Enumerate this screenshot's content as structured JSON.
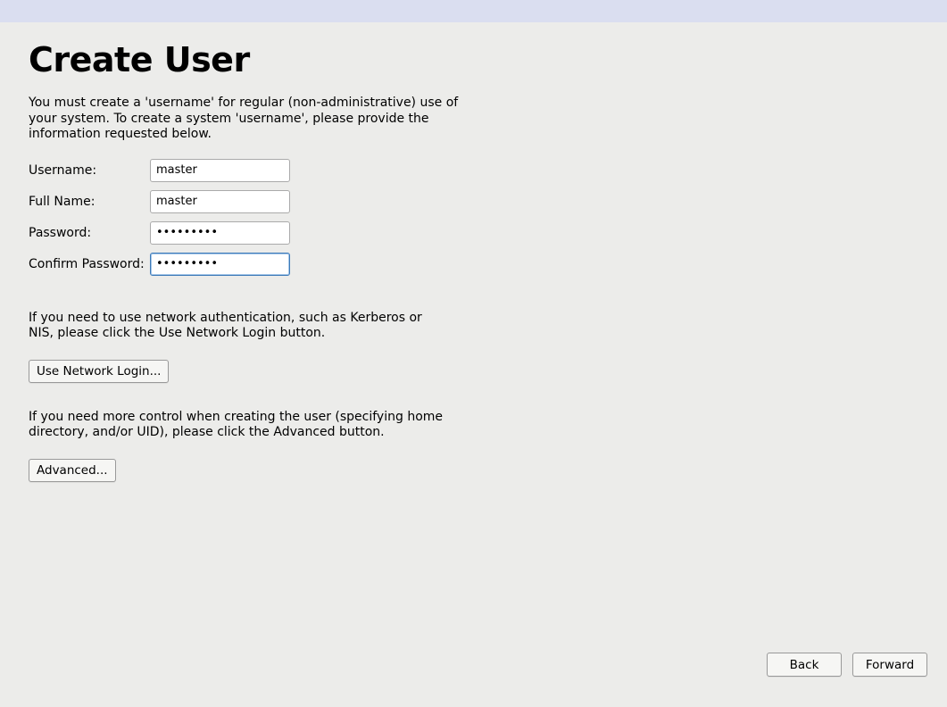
{
  "header": {
    "title": "Create User"
  },
  "intro": "You must create a 'username' for regular (non-administrative) use of your system.  To create a system 'username', please provide the information requested below.",
  "form": {
    "username": {
      "label": "Username:",
      "value": "master"
    },
    "fullname": {
      "label": "Full Name:",
      "value": "master"
    },
    "password": {
      "label": "Password:",
      "value": "•••••••••"
    },
    "confirm": {
      "label": "Confirm Password:",
      "value": "•••••••••"
    }
  },
  "network_text": "If you need to use network authentication, such as Kerberos or NIS, please click the Use Network Login button.",
  "network_button": "Use Network Login...",
  "advanced_text": "If you need more control when creating the user (specifying home directory, and/or UID), please click the Advanced button.",
  "advanced_button": "Advanced...",
  "footer": {
    "back": "Back",
    "forward": "Forward"
  }
}
